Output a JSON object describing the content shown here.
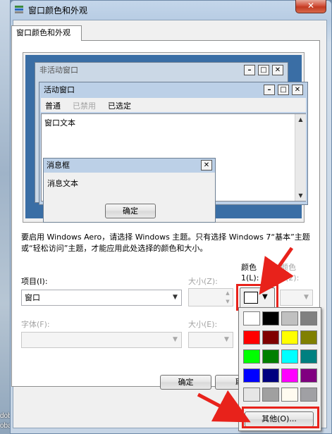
{
  "window": {
    "title": "窗口颜色和外观"
  },
  "tab": {
    "label": "窗口颜色和外观"
  },
  "desktop_side": {
    "line1": "dobe",
    "line2": "obat..."
  },
  "preview": {
    "inactive_title": "非活动窗口",
    "active_title": "活动窗口",
    "menu": {
      "normal": "普通",
      "disabled": "已禁用",
      "selected": "已选定"
    },
    "window_text": "窗口文本",
    "message_box": {
      "title": "消息框",
      "text": "消息文本",
      "ok": "确定"
    }
  },
  "description": "要启用 Windows Aero，请选择 Windows 主题。只有选择 Windows 7“基本”主题或“轻松访问”主题，才能应用此处选择的颜色和大小。",
  "item": {
    "label": "项目(I):",
    "value": "窗口"
  },
  "size1": {
    "label": "大小(Z):"
  },
  "color1": {
    "label_line1": "颜色",
    "label_line2": "1(L):"
  },
  "color2": {
    "label_line1": "颜色",
    "label_line2": "2(2):"
  },
  "font": {
    "label": "字体(F):"
  },
  "size2": {
    "label": "大小(E):"
  },
  "buttons": {
    "ok": "确定",
    "cancel": "取"
  },
  "palette": {
    "colors": [
      "#ffffff",
      "#000000",
      "#c0c0c0",
      "#808080",
      "#ff0000",
      "#800000",
      "#ffff00",
      "#808000",
      "#00ff00",
      "#008000",
      "#00ffff",
      "#008080",
      "#0000ff",
      "#000080",
      "#ff00ff",
      "#800080",
      "#e6e6e6",
      "#a0a0a0",
      "#fffbf0",
      "#a0a0a4"
    ],
    "other": "其他(O)..."
  },
  "accent": {
    "annotation_red": "#e8221b",
    "title_blue": "#bcd0e7"
  }
}
